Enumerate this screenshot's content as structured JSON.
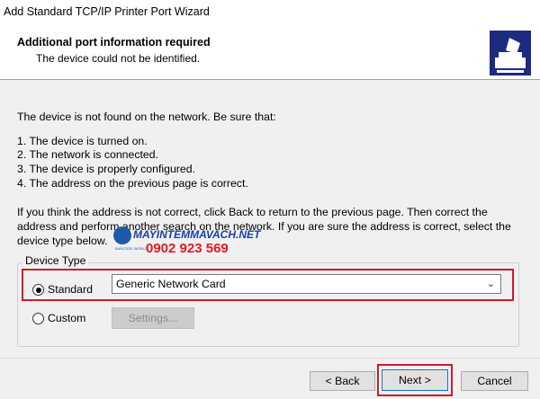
{
  "window": {
    "title": "Add Standard TCP/IP Printer Port Wizard"
  },
  "header": {
    "title": "Additional port information required",
    "subtitle": "The device could not be identified.",
    "icon": "printer-wizard-icon"
  },
  "body": {
    "intro": "The device is not found on the network.  Be sure that:",
    "checklist": [
      "1.  The device is turned on.",
      "2.  The network is connected.",
      "3.  The device is properly configured.",
      "4.  The address on the previous page is correct."
    ],
    "instructions": [
      "If you think the address is not correct, click Back to return to the previous page.  Then correct the",
      "address and perform another search on the network.  If you are sure the address is correct, select the",
      "device type below."
    ]
  },
  "device_type": {
    "legend": "Device Type",
    "standard": {
      "label": "Standard",
      "selected": true,
      "value": "Generic Network Card"
    },
    "custom": {
      "label": "Custom",
      "selected": false,
      "settings_label": "Settings..."
    }
  },
  "buttons": {
    "back": "< Back",
    "next": "Next >",
    "cancel": "Cancel"
  },
  "watermark": {
    "site": "MAYINTEMMAVACH.NET",
    "phone": "0902 923 569",
    "small": "BARCODE WORLD"
  },
  "colors": {
    "highlight_box": "#d11a2a",
    "header_icon_bg": "#1c2a80"
  }
}
